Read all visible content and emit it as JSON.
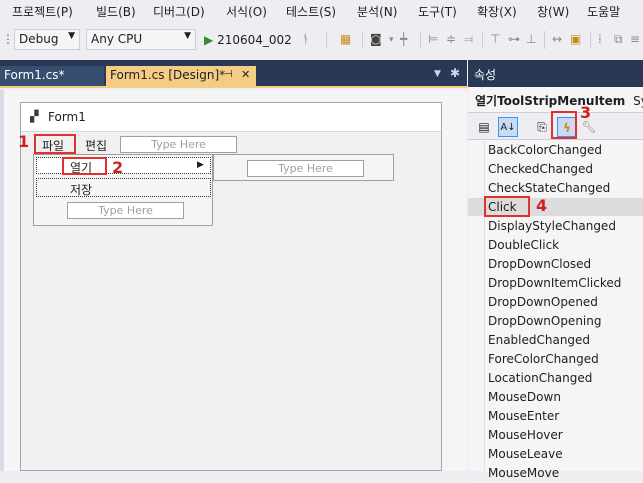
{
  "menubar": {
    "items": [
      "프로젝트(P)",
      "빌드(B)",
      "디버그(D)",
      "서식(O)",
      "테스트(S)",
      "분석(N)",
      "도구(T)",
      "확장(X)",
      "창(W)",
      "도움말"
    ]
  },
  "toolbar": {
    "config": "Debug",
    "platform": "Any CPU",
    "run_target": "210604_002"
  },
  "tabs": {
    "tab1": "Form1.cs*",
    "tab2": "Form1.cs [Design]*",
    "tab2_pin": "⊣",
    "tab2_close": "✕"
  },
  "form": {
    "title": "Form1",
    "menu_file": "파일",
    "menu_edit": "편집",
    "type_here": "Type Here",
    "item_open": "열기",
    "item_save": "저장"
  },
  "annotations": [
    "1",
    "2",
    "3",
    "4"
  ],
  "properties": {
    "header": "속성",
    "object_name": "열기ToolStripMenuItem",
    "object_type": "Syste",
    "events": [
      "BackColorChanged",
      "CheckedChanged",
      "CheckStateChanged",
      "Click",
      "DisplayStyleChanged",
      "DoubleClick",
      "DropDownClosed",
      "DropDownItemClicked",
      "DropDownOpened",
      "DropDownOpening",
      "EnabledChanged",
      "ForeColorChanged",
      "LocationChanged",
      "MouseDown",
      "MouseEnter",
      "MouseHover",
      "MouseLeave",
      "MouseMove"
    ],
    "selected_event": "Click"
  },
  "colors": {
    "accent_tab": "#f5cc84",
    "dark_header": "#293955",
    "annotation_red": "#e03030"
  }
}
